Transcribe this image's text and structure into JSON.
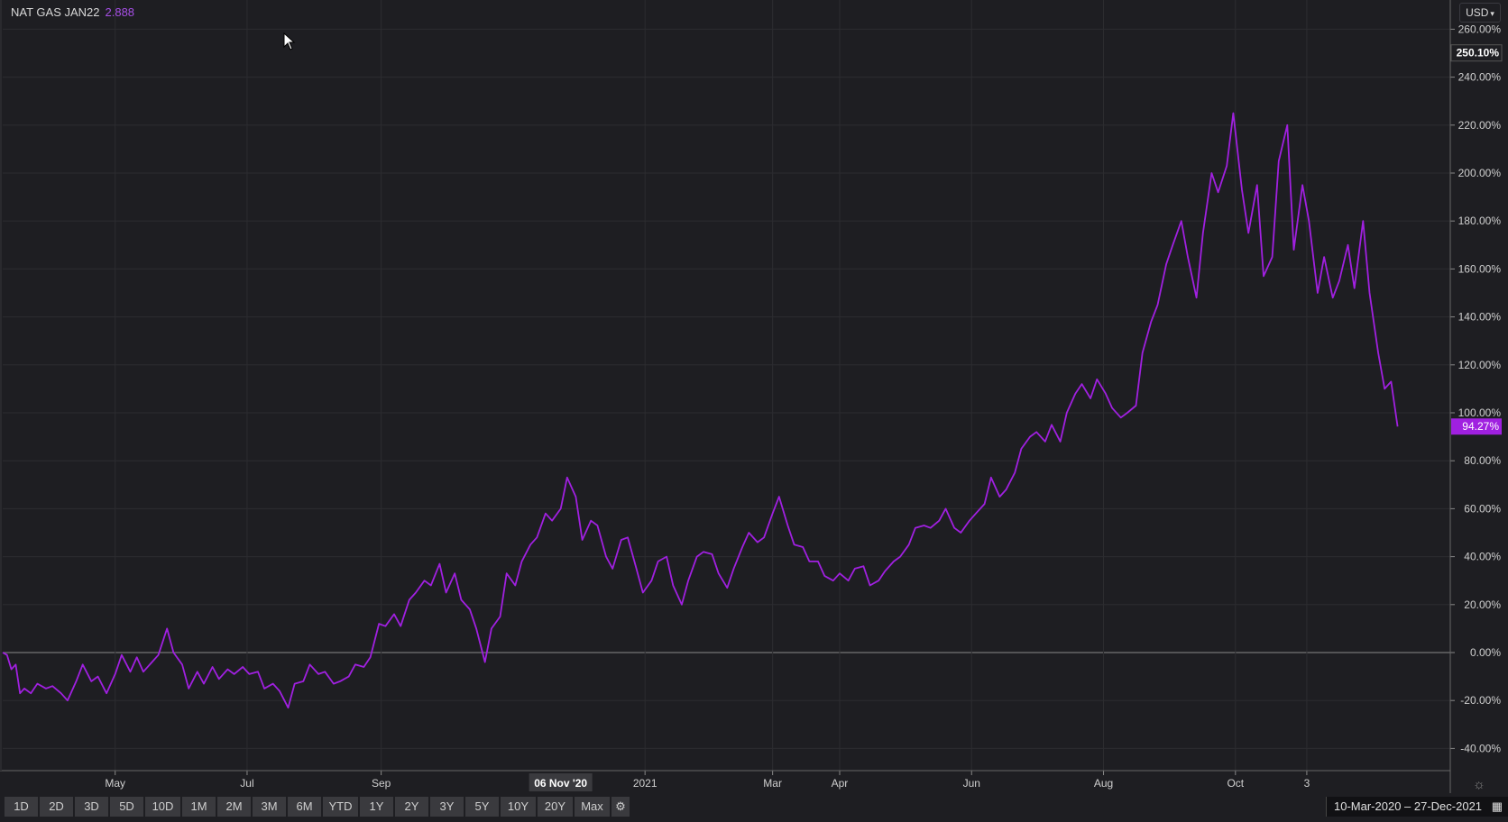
{
  "legend": {
    "symbol": "NAT GAS JAN22",
    "value": "2.888"
  },
  "currency": {
    "label": "USD",
    "icon": "chevron-down-icon"
  },
  "colors": {
    "background": "#1e1e22",
    "line": "#a020e0",
    "grid": "#2c2c30",
    "zero_line": "#8a8a8a",
    "axis_text": "#cfcfcf",
    "price_label_bg": "#a020e0"
  },
  "toolbar": {
    "buttons": [
      "1D",
      "2D",
      "3D",
      "5D",
      "10D",
      "1M",
      "2M",
      "3M",
      "6M",
      "YTD",
      "1Y",
      "2Y",
      "3Y",
      "5Y",
      "10Y",
      "20Y",
      "Max"
    ],
    "settings_icon": "gear-icon"
  },
  "date_range": {
    "label": "10-Mar-2020  –  27-Dec-2021",
    "icon": "calendar-icon"
  },
  "crosshair_date": "06 Nov '20",
  "chart_data": {
    "type": "line",
    "title": "",
    "xlabel": "",
    "ylabel": "",
    "ylim": [
      -50,
      265
    ],
    "y_ticks": [
      "260.00%",
      "240.00%",
      "220.00%",
      "200.00%",
      "180.00%",
      "160.00%",
      "140.00%",
      "120.00%",
      "100.00%",
      "80.00%",
      "60.00%",
      "40.00%",
      "20.00%",
      "0.00%",
      "-20.00%",
      "-40.00%"
    ],
    "y_tick_values": [
      260,
      240,
      220,
      200,
      180,
      160,
      140,
      120,
      100,
      80,
      60,
      40,
      20,
      0,
      -20,
      -40
    ],
    "x_ticks": [
      {
        "label": "May",
        "date": "2020-05-01"
      },
      {
        "label": "Jul",
        "date": "2020-07-01"
      },
      {
        "label": "Sep",
        "date": "2020-09-01"
      },
      {
        "label": "2021",
        "date": "2021-01-01"
      },
      {
        "label": "Mar",
        "date": "2021-03-01"
      },
      {
        "label": "Apr",
        "date": "2021-04-01"
      },
      {
        "label": "Jun",
        "date": "2021-06-01"
      },
      {
        "label": "Aug",
        "date": "2021-08-01"
      },
      {
        "label": "Oct",
        "date": "2021-10-01"
      },
      {
        "label": "3",
        "date": "2021-11-03"
      }
    ],
    "x_range": [
      "2020-03-10",
      "2021-12-31"
    ],
    "price_labels": [
      {
        "text": "250.10%",
        "value": 250.1,
        "style": "high"
      },
      {
        "text": "94.27%",
        "value": 94.27,
        "style": "last"
      }
    ],
    "grid": true,
    "series": [
      {
        "points": [
          [
            "2020-03-10",
            0
          ],
          [
            "2020-03-12",
            -1
          ],
          [
            "2020-03-14",
            -7
          ],
          [
            "2020-03-16",
            -5
          ],
          [
            "2020-03-18",
            -17
          ],
          [
            "2020-03-20",
            -15
          ],
          [
            "2020-03-23",
            -17
          ],
          [
            "2020-03-26",
            -13
          ],
          [
            "2020-03-30",
            -15
          ],
          [
            "2020-04-02",
            -14
          ],
          [
            "2020-04-06",
            -17
          ],
          [
            "2020-04-09",
            -20
          ],
          [
            "2020-04-13",
            -12
          ],
          [
            "2020-04-16",
            -5
          ],
          [
            "2020-04-20",
            -12
          ],
          [
            "2020-04-23",
            -10
          ],
          [
            "2020-04-27",
            -17
          ],
          [
            "2020-05-01",
            -9
          ],
          [
            "2020-05-04",
            -1
          ],
          [
            "2020-05-08",
            -8
          ],
          [
            "2020-05-11",
            -2
          ],
          [
            "2020-05-14",
            -8
          ],
          [
            "2020-05-18",
            -4
          ],
          [
            "2020-05-21",
            -1
          ],
          [
            "2020-05-25",
            10
          ],
          [
            "2020-05-28",
            0
          ],
          [
            "2020-06-01",
            -5
          ],
          [
            "2020-06-04",
            -15
          ],
          [
            "2020-06-08",
            -8
          ],
          [
            "2020-06-11",
            -13
          ],
          [
            "2020-06-15",
            -6
          ],
          [
            "2020-06-18",
            -11
          ],
          [
            "2020-06-22",
            -7
          ],
          [
            "2020-06-25",
            -9
          ],
          [
            "2020-06-29",
            -6
          ],
          [
            "2020-07-02",
            -9
          ],
          [
            "2020-07-06",
            -8
          ],
          [
            "2020-07-09",
            -15
          ],
          [
            "2020-07-13",
            -13
          ],
          [
            "2020-07-16",
            -16
          ],
          [
            "2020-07-20",
            -23
          ],
          [
            "2020-07-23",
            -13
          ],
          [
            "2020-07-27",
            -12
          ],
          [
            "2020-07-30",
            -5
          ],
          [
            "2020-08-03",
            -9
          ],
          [
            "2020-08-06",
            -8
          ],
          [
            "2020-08-10",
            -13
          ],
          [
            "2020-08-13",
            -12
          ],
          [
            "2020-08-17",
            -10
          ],
          [
            "2020-08-20",
            -5
          ],
          [
            "2020-08-24",
            -6
          ],
          [
            "2020-08-27",
            -2
          ],
          [
            "2020-08-31",
            12
          ],
          [
            "2020-09-03",
            11
          ],
          [
            "2020-09-07",
            16
          ],
          [
            "2020-09-10",
            11
          ],
          [
            "2020-09-14",
            22
          ],
          [
            "2020-09-17",
            25
          ],
          [
            "2020-09-21",
            30
          ],
          [
            "2020-09-24",
            28
          ],
          [
            "2020-09-28",
            37
          ],
          [
            "2020-10-01",
            25
          ],
          [
            "2020-10-05",
            33
          ],
          [
            "2020-10-08",
            22
          ],
          [
            "2020-10-12",
            18
          ],
          [
            "2020-10-15",
            10
          ],
          [
            "2020-10-19",
            -4
          ],
          [
            "2020-10-22",
            10
          ],
          [
            "2020-10-26",
            15
          ],
          [
            "2020-10-29",
            33
          ],
          [
            "2020-11-02",
            28
          ],
          [
            "2020-11-05",
            38
          ],
          [
            "2020-11-09",
            45
          ],
          [
            "2020-11-12",
            48
          ],
          [
            "2020-11-16",
            58
          ],
          [
            "2020-11-19",
            55
          ],
          [
            "2020-11-23",
            60
          ],
          [
            "2020-11-26",
            73
          ],
          [
            "2020-11-30",
            65
          ],
          [
            "2020-12-03",
            47
          ],
          [
            "2020-12-07",
            55
          ],
          [
            "2020-12-10",
            53
          ],
          [
            "2020-12-14",
            40
          ],
          [
            "2020-12-17",
            35
          ],
          [
            "2020-12-21",
            47
          ],
          [
            "2020-12-24",
            48
          ],
          [
            "2020-12-28",
            35
          ],
          [
            "2020-12-31",
            25
          ],
          [
            "2021-01-04",
            30
          ],
          [
            "2021-01-07",
            38
          ],
          [
            "2021-01-11",
            40
          ],
          [
            "2021-01-14",
            28
          ],
          [
            "2021-01-18",
            20
          ],
          [
            "2021-01-21",
            30
          ],
          [
            "2021-01-25",
            40
          ],
          [
            "2021-01-28",
            42
          ],
          [
            "2021-02-01",
            41
          ],
          [
            "2021-02-04",
            33
          ],
          [
            "2021-02-08",
            27
          ],
          [
            "2021-02-11",
            35
          ],
          [
            "2021-02-15",
            44
          ],
          [
            "2021-02-18",
            50
          ],
          [
            "2021-02-22",
            46
          ],
          [
            "2021-02-25",
            48
          ],
          [
            "2021-03-01",
            58
          ],
          [
            "2021-03-04",
            65
          ],
          [
            "2021-03-08",
            53
          ],
          [
            "2021-03-11",
            45
          ],
          [
            "2021-03-15",
            44
          ],
          [
            "2021-03-18",
            38
          ],
          [
            "2021-03-22",
            38
          ],
          [
            "2021-03-25",
            32
          ],
          [
            "2021-03-29",
            30
          ],
          [
            "2021-04-01",
            33
          ],
          [
            "2021-04-05",
            30
          ],
          [
            "2021-04-08",
            35
          ],
          [
            "2021-04-12",
            36
          ],
          [
            "2021-04-15",
            28
          ],
          [
            "2021-04-19",
            30
          ],
          [
            "2021-04-22",
            34
          ],
          [
            "2021-04-26",
            38
          ],
          [
            "2021-04-29",
            40
          ],
          [
            "2021-05-03",
            45
          ],
          [
            "2021-05-06",
            52
          ],
          [
            "2021-05-10",
            53
          ],
          [
            "2021-05-13",
            52
          ],
          [
            "2021-05-17",
            55
          ],
          [
            "2021-05-20",
            60
          ],
          [
            "2021-05-24",
            52
          ],
          [
            "2021-05-27",
            50
          ],
          [
            "2021-05-31",
            55
          ],
          [
            "2021-06-03",
            58
          ],
          [
            "2021-06-07",
            62
          ],
          [
            "2021-06-10",
            73
          ],
          [
            "2021-06-14",
            65
          ],
          [
            "2021-06-17",
            68
          ],
          [
            "2021-06-21",
            75
          ],
          [
            "2021-06-24",
            85
          ],
          [
            "2021-06-28",
            90
          ],
          [
            "2021-07-01",
            92
          ],
          [
            "2021-07-05",
            88
          ],
          [
            "2021-07-08",
            95
          ],
          [
            "2021-07-12",
            88
          ],
          [
            "2021-07-15",
            100
          ],
          [
            "2021-07-19",
            108
          ],
          [
            "2021-07-22",
            112
          ],
          [
            "2021-07-26",
            106
          ],
          [
            "2021-07-29",
            114
          ],
          [
            "2021-08-02",
            108
          ],
          [
            "2021-08-05",
            102
          ],
          [
            "2021-08-09",
            98
          ],
          [
            "2021-08-12",
            100
          ],
          [
            "2021-08-16",
            103
          ],
          [
            "2021-08-19",
            125
          ],
          [
            "2021-08-23",
            138
          ],
          [
            "2021-08-26",
            145
          ],
          [
            "2021-08-30",
            162
          ],
          [
            "2021-09-02",
            170
          ],
          [
            "2021-09-06",
            180
          ],
          [
            "2021-09-09",
            165
          ],
          [
            "2021-09-13",
            148
          ],
          [
            "2021-09-16",
            175
          ],
          [
            "2021-09-20",
            200
          ],
          [
            "2021-09-23",
            192
          ],
          [
            "2021-09-27",
            203
          ],
          [
            "2021-09-30",
            225
          ],
          [
            "2021-10-04",
            193
          ],
          [
            "2021-10-07",
            175
          ],
          [
            "2021-10-11",
            195
          ],
          [
            "2021-10-14",
            157
          ],
          [
            "2021-10-18",
            165
          ],
          [
            "2021-10-21",
            205
          ],
          [
            "2021-10-25",
            220
          ],
          [
            "2021-10-28",
            168
          ],
          [
            "2021-11-01",
            195
          ],
          [
            "2021-11-04",
            180
          ],
          [
            "2021-11-08",
            150
          ],
          [
            "2021-11-11",
            165
          ],
          [
            "2021-11-15",
            148
          ],
          [
            "2021-11-18",
            155
          ],
          [
            "2021-11-22",
            170
          ],
          [
            "2021-11-25",
            152
          ],
          [
            "2021-11-29",
            180
          ],
          [
            "2021-12-02",
            150
          ],
          [
            "2021-12-06",
            125
          ],
          [
            "2021-12-09",
            110
          ],
          [
            "2021-12-12",
            113
          ],
          [
            "2021-12-15",
            94.27
          ]
        ]
      }
    ]
  }
}
